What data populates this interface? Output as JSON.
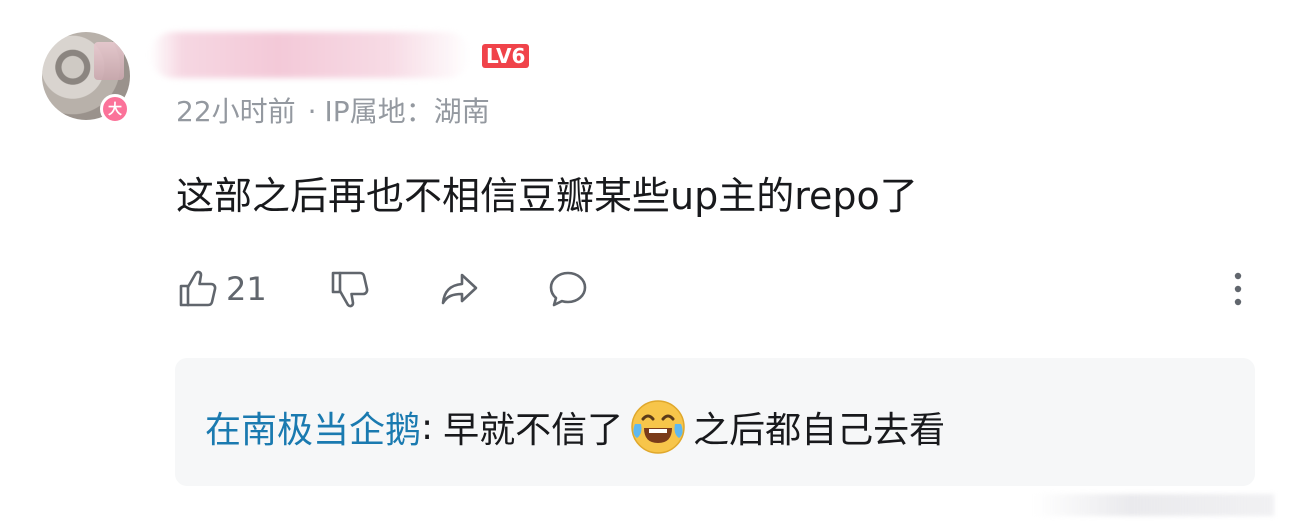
{
  "comment": {
    "avatar_badge": "大",
    "username": "",
    "level": "LV6",
    "time": "22小时前",
    "separator": "·",
    "location": "IP属地：湖南",
    "text": "这部之后再也不相信豆瓣某些up主的repo了",
    "like_count": "21"
  },
  "actions": {
    "like_icon": "thumbs-up-icon",
    "dislike_icon": "thumbs-down-icon",
    "share_icon": "share-icon",
    "reply_icon": "comment-bubble-icon",
    "more_icon": "more-vertical-icon"
  },
  "reply": {
    "author": "在南极当企鹅",
    "colon": ":",
    "text_before": "早就不信了",
    "emoji": "laughing-tears-emoji",
    "text_after": "之后都自己去看"
  },
  "colors": {
    "level_badge": "#f0434a",
    "vip_badge": "#fb7299",
    "reply_author": "#1a7ab0",
    "reply_bg": "#f6f7f8",
    "meta_text": "#9499a0"
  }
}
